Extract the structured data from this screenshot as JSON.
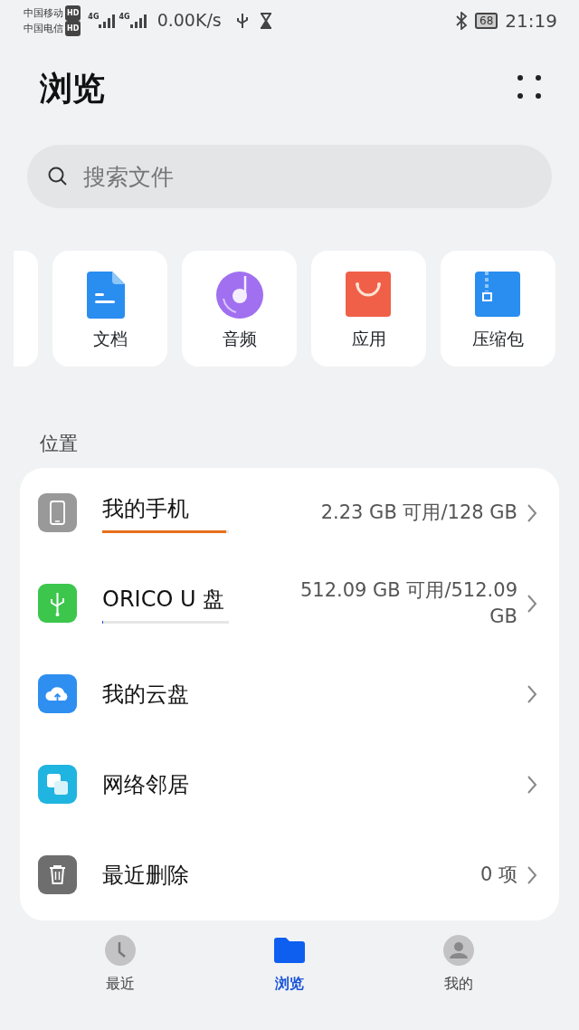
{
  "status_bar": {
    "carriers": [
      {
        "name": "中国移动",
        "badge": "HD"
      },
      {
        "name": "中国电信",
        "badge": "HD"
      }
    ],
    "signals": [
      {
        "label": "4G"
      },
      {
        "label": "4G"
      }
    ],
    "speed": "0.00K/s",
    "battery": "68",
    "time": "21:19"
  },
  "header": {
    "title": "浏览"
  },
  "search": {
    "placeholder": "搜索文件"
  },
  "categories": [
    {
      "kind": "doc",
      "label": "文档"
    },
    {
      "kind": "audio",
      "label": "音频"
    },
    {
      "kind": "app",
      "label": "应用"
    },
    {
      "kind": "zip",
      "label": "压缩包"
    }
  ],
  "locations": {
    "heading": "位置",
    "items": [
      {
        "kind": "phone",
        "name": "我的手机",
        "detail": "2.23 GB 可用/128 GB",
        "level": 0.98,
        "color": "#e8701a"
      },
      {
        "kind": "usb",
        "name": "ORICO U 盘",
        "detail": "512.09 GB 可用/512.09 GB",
        "level": 0.01,
        "color": "#1a55d8"
      },
      {
        "kind": "cloud",
        "name": "我的云盘"
      },
      {
        "kind": "network",
        "name": "网络邻居"
      },
      {
        "kind": "trash",
        "name": "最近删除",
        "detail": "0 项"
      }
    ]
  },
  "bottom_nav": [
    {
      "kind": "recent",
      "label": "最近",
      "selected": false
    },
    {
      "kind": "browse",
      "label": "浏览",
      "selected": true
    },
    {
      "kind": "me",
      "label": "我的",
      "selected": false
    }
  ]
}
